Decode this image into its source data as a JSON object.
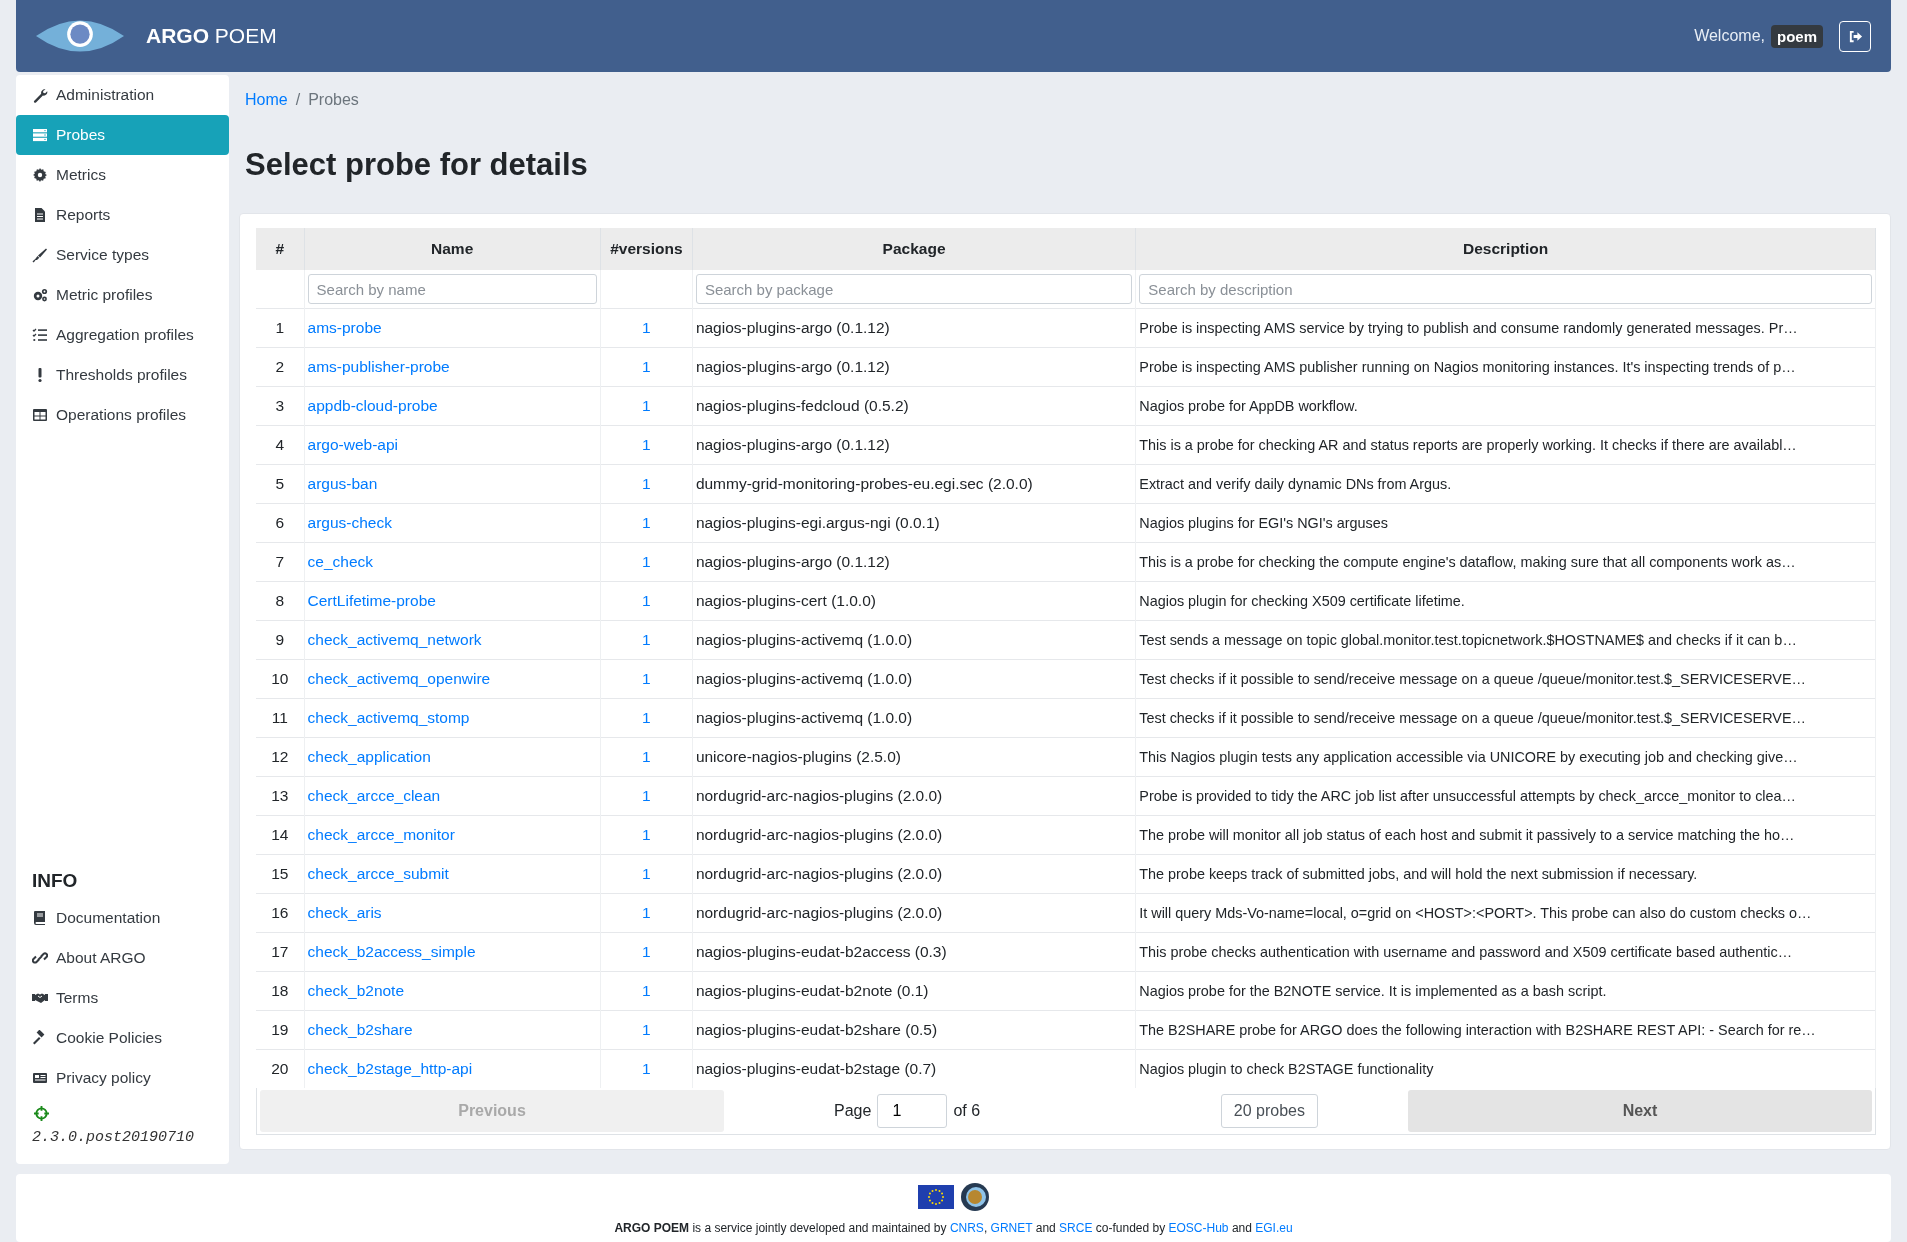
{
  "header": {
    "brand_bold": "ARGO",
    "brand": "POEM",
    "welcome": "Welcome,",
    "user": "poem"
  },
  "sidebar": {
    "items": [
      {
        "label": "Administration",
        "selected": false
      },
      {
        "label": "Probes",
        "selected": true
      },
      {
        "label": "Metrics",
        "selected": false
      },
      {
        "label": "Reports",
        "selected": false
      },
      {
        "label": "Service types",
        "selected": false
      },
      {
        "label": "Metric profiles",
        "selected": false
      },
      {
        "label": "Aggregation profiles",
        "selected": false
      },
      {
        "label": "Thresholds profiles",
        "selected": false
      },
      {
        "label": "Operations profiles",
        "selected": false
      }
    ],
    "info_title": "INFO",
    "info_items": [
      {
        "label": "Documentation"
      },
      {
        "label": "About ARGO"
      },
      {
        "label": "Terms"
      },
      {
        "label": "Cookie Policies"
      },
      {
        "label": "Privacy policy"
      }
    ],
    "version": "2.3.0.post20190710"
  },
  "breadcrumb_separator": "/",
  "breadcrumb": [
    {
      "label": "Home",
      "kind": "link"
    },
    {
      "label": "Probes",
      "kind": "current"
    }
  ],
  "title": "Select probe for details",
  "table": {
    "columns": [
      {
        "label": "#"
      },
      {
        "label": "Name",
        "placeholder": "Search by name"
      },
      {
        "label": "#versions"
      },
      {
        "label": "Package",
        "placeholder": "Search by package"
      },
      {
        "label": "Description",
        "placeholder": "Search by description"
      }
    ],
    "rows": [
      {
        "number": "1",
        "name": "ams-probe",
        "versions": "1",
        "package": "nagios-plugins-argo (0.1.12)",
        "description": "Probe is inspecting AMS service by trying to publish and consume randomly generated messages. Pr…"
      },
      {
        "number": "2",
        "name": "ams-publisher-probe",
        "versions": "1",
        "package": "nagios-plugins-argo (0.1.12)",
        "description": "Probe is inspecting AMS publisher running on Nagios monitoring instances. It's inspecting trends of p…"
      },
      {
        "number": "3",
        "name": "appdb-cloud-probe",
        "versions": "1",
        "package": "nagios-plugins-fedcloud (0.5.2)",
        "description": "Nagios probe for AppDB workflow."
      },
      {
        "number": "4",
        "name": "argo-web-api",
        "versions": "1",
        "package": "nagios-plugins-argo (0.1.12)",
        "description": "This is a probe for checking AR and status reports are properly working. It checks if there are availabl…"
      },
      {
        "number": "5",
        "name": "argus-ban",
        "versions": "1",
        "package": "dummy-grid-monitoring-probes-eu.egi.sec (2.0.0)",
        "description": "Extract and verify daily dynamic DNs from Argus."
      },
      {
        "number": "6",
        "name": "argus-check",
        "versions": "1",
        "package": "nagios-plugins-egi.argus-ngi (0.0.1)",
        "description": "Nagios plugins for EGI's NGI's arguses"
      },
      {
        "number": "7",
        "name": "ce_check",
        "versions": "1",
        "package": "nagios-plugins-argo (0.1.12)",
        "description": "This is a probe for checking the compute engine's dataflow, making sure that all components work as…"
      },
      {
        "number": "8",
        "name": "CertLifetime-probe",
        "versions": "1",
        "package": "nagios-plugins-cert (1.0.0)",
        "description": "Nagios plugin for checking X509 certificate lifetime."
      },
      {
        "number": "9",
        "name": "check_activemq_network",
        "versions": "1",
        "package": "nagios-plugins-activemq (1.0.0)",
        "description": "Test sends a message on topic global.monitor.test.topicnetwork.$HOSTNAME$ and checks if it can b…"
      },
      {
        "number": "10",
        "name": "check_activemq_openwire",
        "versions": "1",
        "package": "nagios-plugins-activemq (1.0.0)",
        "description": "Test checks if it possible to send/receive message on a queue /queue/monitor.test.$_SERVICESERVE…"
      },
      {
        "number": "11",
        "name": "check_activemq_stomp",
        "versions": "1",
        "package": "nagios-plugins-activemq (1.0.0)",
        "description": "Test checks if it possible to send/receive message on a queue /queue/monitor.test.$_SERVICESERVE…"
      },
      {
        "number": "12",
        "name": "check_application",
        "versions": "1",
        "package": "unicore-nagios-plugins (2.5.0)",
        "description": "This Nagios plugin tests any application accessible via UNICORE by executing job  and checking give…"
      },
      {
        "number": "13",
        "name": "check_arcce_clean",
        "versions": "1",
        "package": "nordugrid-arc-nagios-plugins (2.0.0)",
        "description": "Probe is provided to tidy the ARC job list after unsuccessful attempts by check_arcce_monitor to clea…"
      },
      {
        "number": "14",
        "name": "check_arcce_monitor",
        "versions": "1",
        "package": "nordugrid-arc-nagios-plugins (2.0.0)",
        "description": "The probe will monitor all job status of each host and submit it passively to a service matching the ho…"
      },
      {
        "number": "15",
        "name": "check_arcce_submit",
        "versions": "1",
        "package": "nordugrid-arc-nagios-plugins (2.0.0)",
        "description": "The probe keeps track of submitted jobs, and will hold the next submission if necessary."
      },
      {
        "number": "16",
        "name": "check_aris",
        "versions": "1",
        "package": "nordugrid-arc-nagios-plugins (2.0.0)",
        "description": "It will query Mds-Vo-name=local, o=grid on <HOST>:<PORT>. This probe can also do custom checks o…"
      },
      {
        "number": "17",
        "name": "check_b2access_simple",
        "versions": "1",
        "package": "nagios-plugins-eudat-b2access (0.3)",
        "description": "This probe checks authentication with username and password and X509 certificate based authentic…"
      },
      {
        "number": "18",
        "name": "check_b2note",
        "versions": "1",
        "package": "nagios-plugins-eudat-b2note (0.1)",
        "description": "Nagios probe for the B2NOTE service. It is implemented as a bash script."
      },
      {
        "number": "19",
        "name": "check_b2share",
        "versions": "1",
        "package": "nagios-plugins-eudat-b2share (0.5)",
        "description": "The B2SHARE probe for ARGO does the following interaction with B2SHARE REST API:  - Search for re…"
      },
      {
        "number": "20",
        "name": "check_b2stage_http-api",
        "versions": "1",
        "package": "nagios-plugins-eudat-b2stage (0.7)",
        "description": "Nagios plugin to check B2STAGE functionality"
      }
    ]
  },
  "pagination": {
    "previous": {
      "label": "Previous",
      "disabled": true
    },
    "page_label": "Page",
    "page": "1",
    "of": "of 6",
    "page_size": "20 probes",
    "next": {
      "label": "Next",
      "disabled": false
    }
  },
  "footer": {
    "parts": [
      {
        "kind": "text",
        "text": "**ARGO POEM** is a service jointly developed and maintained by"
      },
      {
        "kind": "link",
        "text": "CNRS"
      },
      {
        "kind": "text",
        "text": ","
      },
      {
        "kind": "link",
        "text": "GRNET"
      },
      {
        "kind": "text",
        "text": "and"
      },
      {
        "kind": "link",
        "text": "SRCE"
      },
      {
        "kind": "text",
        "text": "co-funded by"
      },
      {
        "kind": "link",
        "text": "EOSC-Hub"
      },
      {
        "kind": "text",
        "text": "and"
      },
      {
        "kind": "link",
        "text": "EGI.eu"
      }
    ]
  }
}
